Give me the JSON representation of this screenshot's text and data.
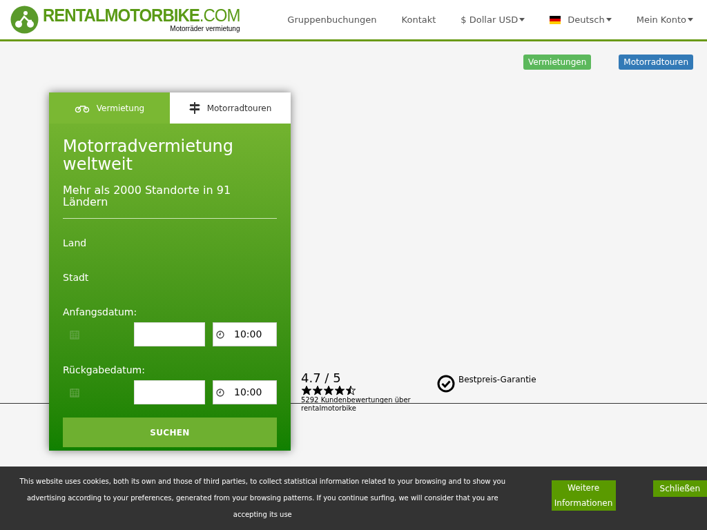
{
  "header": {
    "logo": {
      "name": "RENTALMOTORBIKE",
      "suffix": ".COM",
      "tagline": "Motorräder vermietung"
    },
    "nav": [
      {
        "label": "Gruppenbuchungen",
        "kind": "link"
      },
      {
        "label": "Kontakt",
        "kind": "link"
      },
      {
        "label": "$ Dollar USD",
        "kind": "dropdown"
      },
      {
        "label": "Deutsch",
        "kind": "language"
      },
      {
        "label": "Mein Konto",
        "kind": "dropdown"
      }
    ]
  },
  "badges": [
    {
      "label": "Vermietungen",
      "color": "#5cb85c"
    },
    {
      "label": "Motorradtouren",
      "color": "#337ab7"
    }
  ],
  "search_card": {
    "tabs": [
      {
        "label": "Vermietung",
        "selected": true,
        "kind": "motorbike"
      },
      {
        "label": "Motorradtouren",
        "selected": false,
        "kind": "signpost"
      }
    ],
    "title": "Motorradvermietung weltweit",
    "subtitle": "Mehr als 2000 Standorte in 91 Ländern",
    "fields": [
      {
        "label": "Land",
        "kind": "select"
      },
      {
        "label": "Stadt",
        "kind": "select"
      },
      {
        "label": "Anfangsdatum:",
        "kind": "datetime",
        "time": "10:00"
      },
      {
        "label": "Rückgabedatum:",
        "kind": "datetime",
        "time": "10:00"
      }
    ],
    "button": "SUCHEN"
  },
  "rating": {
    "score": "4.7 / 5",
    "stars": 4.5,
    "reviews": "5292 Kundenbewertungen über rentalmotorbike"
  },
  "guarantee": "Bestpreis-Garantie",
  "cookie_bar": {
    "text": "This website uses cookies, both its own and those of third parties, to collect statistical information related to your browsing and to show you advertising according to your preferences, generated from your browsing patterns. If you continue surfing, we will consider that you are accepting its use",
    "buttons": [
      "Weitere Informationen",
      "Schließen"
    ]
  }
}
